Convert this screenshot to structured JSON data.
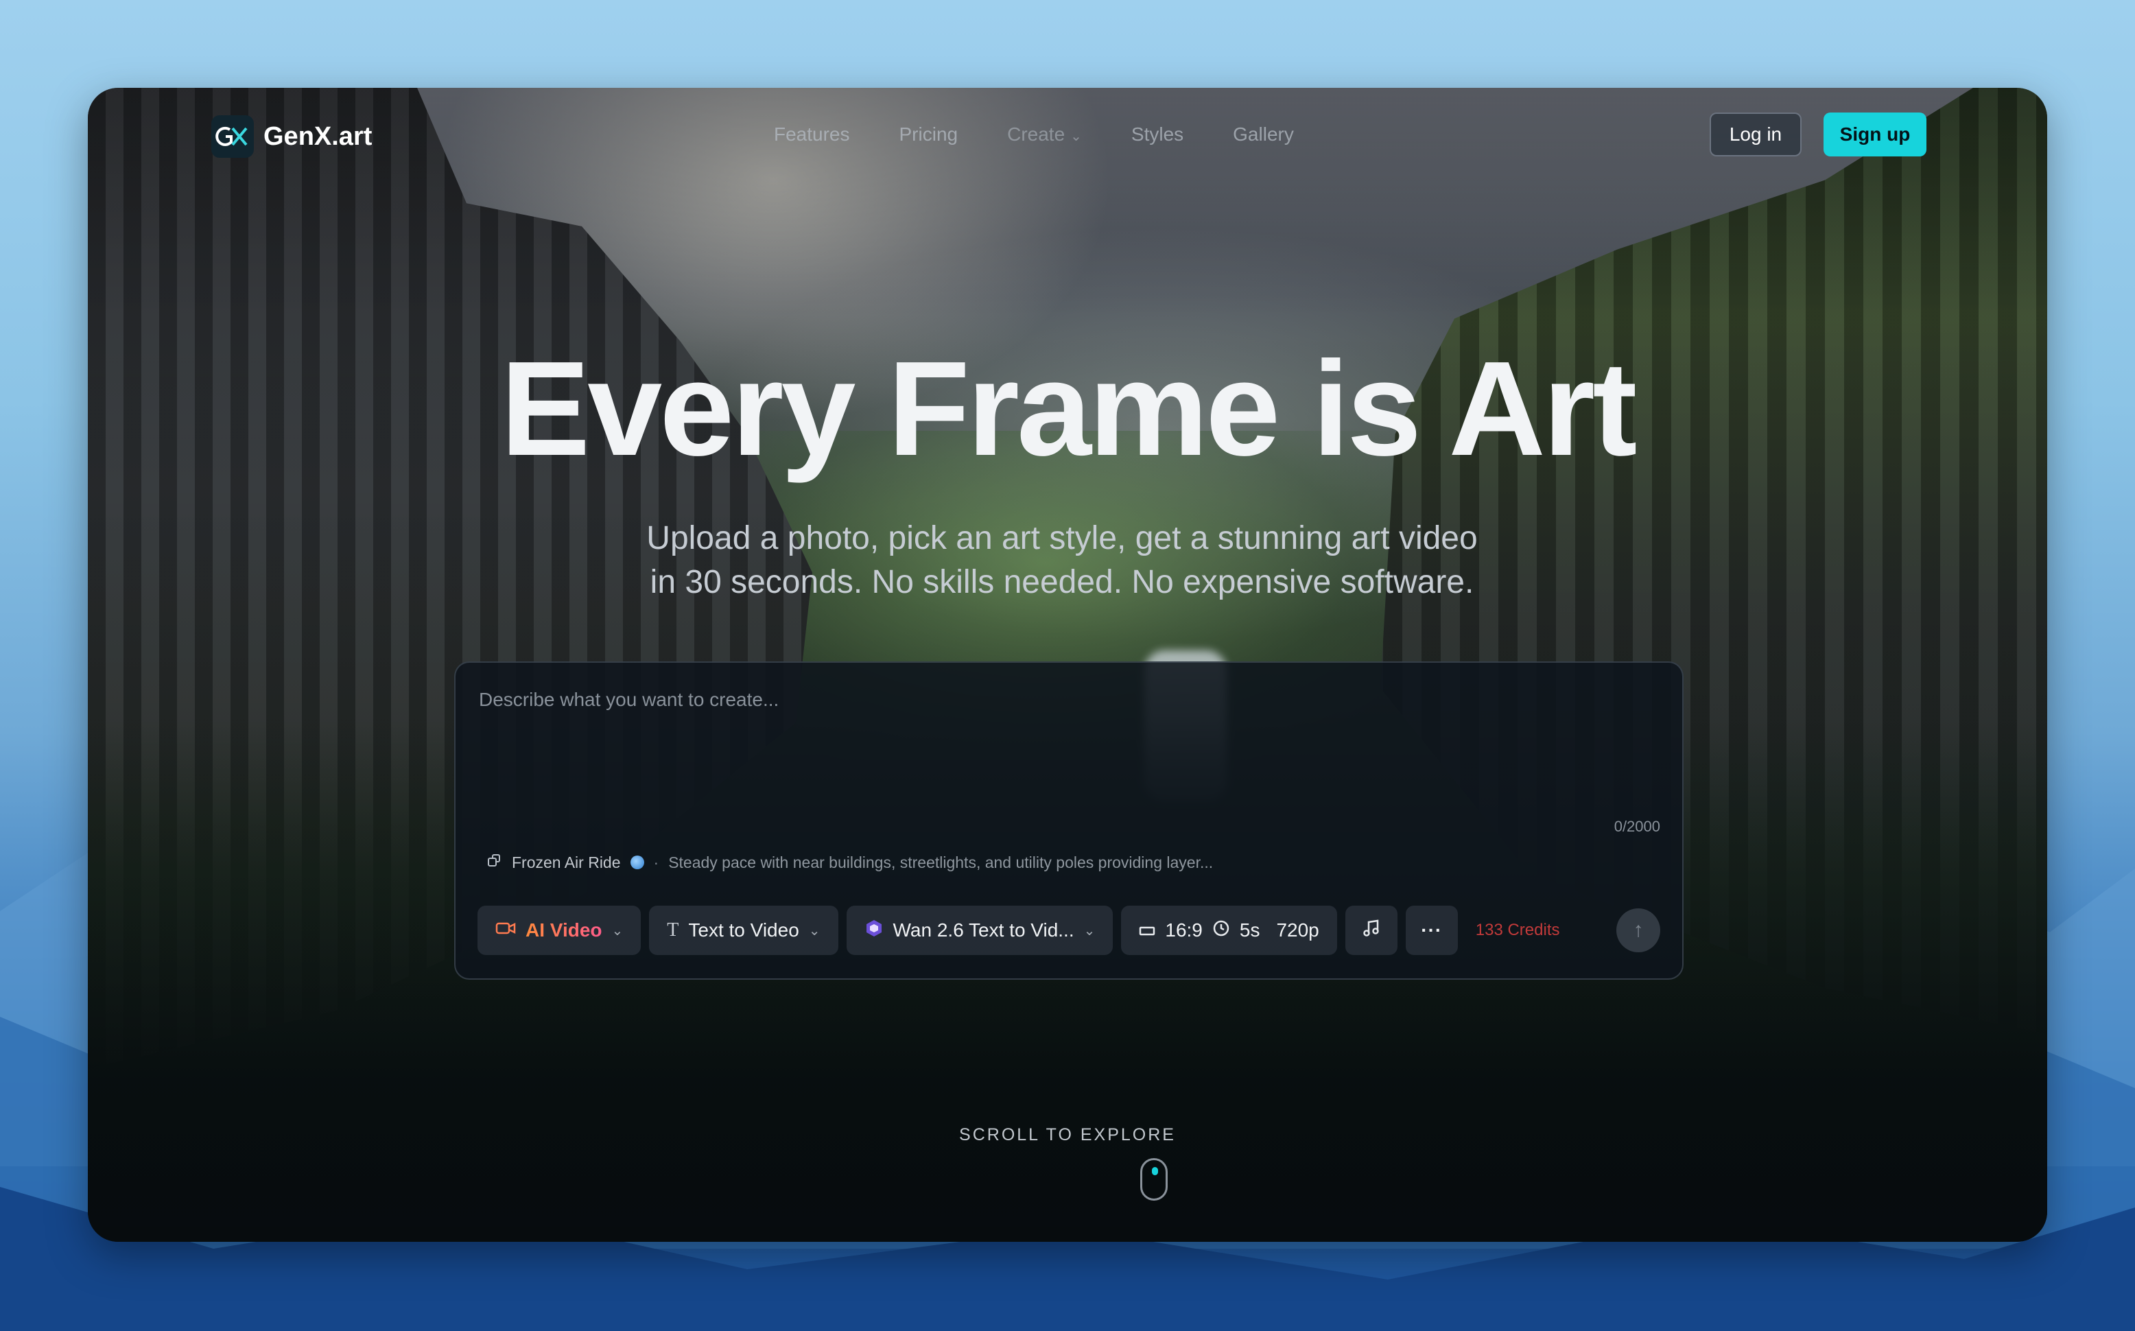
{
  "brand": {
    "name": "GenX.art",
    "logo_icon": "genx-logo-icon",
    "accent": "#17d3dc"
  },
  "nav": {
    "links": [
      "Features",
      "Pricing",
      "Create",
      "Styles",
      "Gallery"
    ],
    "login_label": "Log in",
    "signup_label": "Sign up"
  },
  "hero": {
    "title": "Every Frame is Art",
    "subtitle_line1": "Upload a photo, pick an art style, get a stunning art video",
    "subtitle_line2": "in 30 seconds. No skills needed. No expensive software."
  },
  "prompt": {
    "placeholder": "Describe what you want to create...",
    "counter": "0/2000",
    "preset_name": "Frozen Air Ride",
    "preset_separator": "·",
    "preset_desc": "Steady pace with near buildings, streetlights, and utility poles providing layer...",
    "toolbar": {
      "mode": "AI Video",
      "type": "Text to Video",
      "model": "Wan 2.6 Text to Vid...",
      "ratio": "16:9",
      "duration": "5s",
      "resolution": "720p",
      "credits": "133 Credits"
    }
  },
  "scroll": {
    "label": "SCROLL TO EXPLORE"
  }
}
